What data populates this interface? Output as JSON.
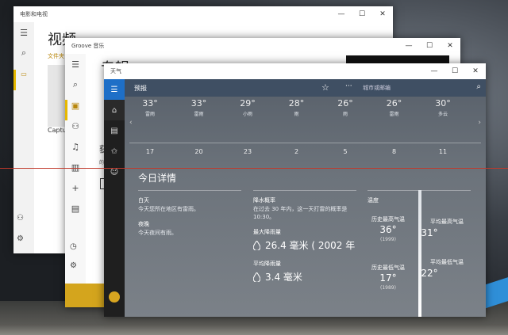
{
  "movies": {
    "title": "电影和电视",
    "heading": "视频",
    "subtitle": "文件夹",
    "caption": "Captu",
    "controls": {
      "min": "—",
      "max": "☐",
      "close": "✕"
    }
  },
  "groove": {
    "title": "Groove 音乐",
    "heading": "专辑",
    "text1": "获",
    "text2": "的",
    "controls": {
      "min": "—",
      "max": "☐",
      "close": "✕"
    }
  },
  "weather": {
    "title": "天气",
    "header": "预报",
    "search_placeholder": "城市或邮编",
    "controls": {
      "min": "—",
      "max": "☐",
      "close": "✕"
    },
    "hourly": [
      {
        "temp": "33°",
        "cond": "雷雨",
        "x": "17"
      },
      {
        "temp": "33°",
        "cond": "雷雨",
        "x": "20"
      },
      {
        "temp": "29°",
        "cond": "小雨",
        "x": "23"
      },
      {
        "temp": "28°",
        "cond": "雨",
        "x": "2"
      },
      {
        "temp": "26°",
        "cond": "雨",
        "x": "5"
      },
      {
        "temp": "26°",
        "cond": "雷雨",
        "x": "8"
      },
      {
        "temp": "30°",
        "cond": "多云",
        "x": "11"
      }
    ],
    "detail": {
      "title": "今日详情",
      "day_label": "白天",
      "day_text": "今天您所在地区有雷雨。",
      "night_label": "夜晚",
      "night_text": "今天夜间有雨。",
      "precip_label": "降水概率",
      "precip_text1": "在过去 30 年内，这一天打雷的概率是",
      "precip_text2": "10:30。",
      "max_rain_label": "最大降雨量",
      "max_rain_value": "26.4 毫米 ( 2002 年",
      "avg_rain_label": "平均降雨量",
      "avg_rain_value": "3.4 毫米",
      "temp_label": "温度",
      "hist_high_label": "历史最高气温",
      "hist_high_value": "36°",
      "hist_high_year": "(1999)",
      "avg_high_label": "平均最高气温",
      "avg_high_value": "31°",
      "hist_low_label": "历史最低气温",
      "hist_low_value": "17°",
      "hist_low_year": "(1989)",
      "avg_low_label": "平均最低气温",
      "avg_low_value": "22°"
    }
  }
}
